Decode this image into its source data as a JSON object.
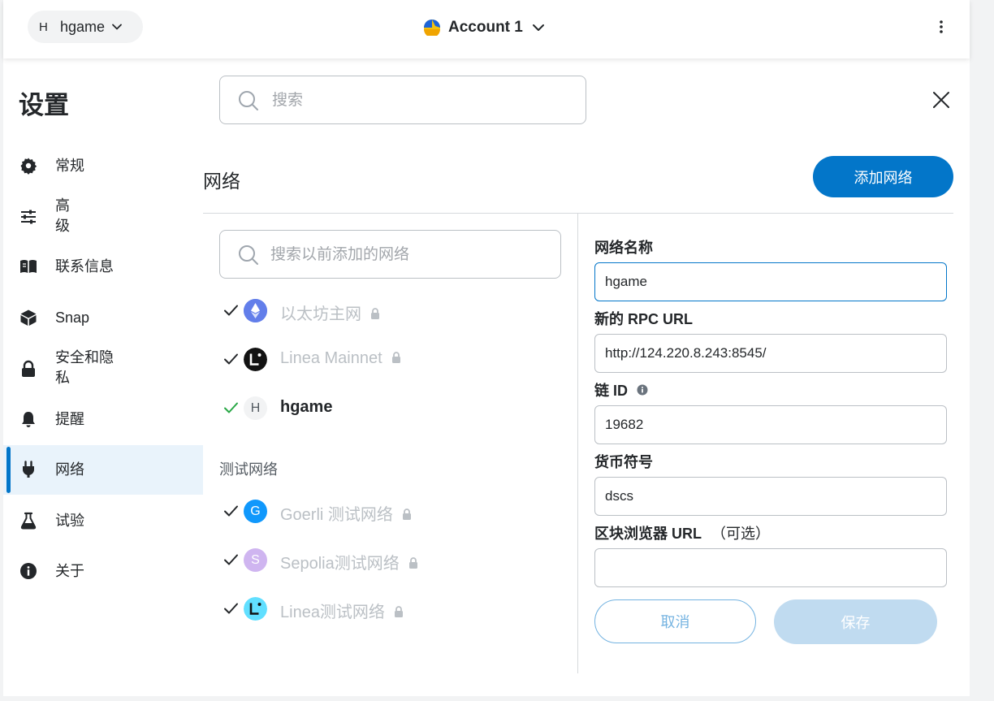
{
  "header": {
    "network_pill": {
      "letter": "H",
      "name": "hgame"
    },
    "account_name": "Account 1"
  },
  "settings": {
    "title": "设置",
    "search_placeholder": "搜索",
    "nav": [
      {
        "label": "常规",
        "icon": "gear-icon"
      },
      {
        "label": "高\n级",
        "icon": "sliders-icon"
      },
      {
        "label": "联系信息",
        "icon": "book-icon"
      },
      {
        "label": "Snap",
        "icon": "cube-icon"
      },
      {
        "label": "安全和隐\n私",
        "icon": "lock-icon"
      },
      {
        "label": "提醒",
        "icon": "bell-icon"
      },
      {
        "label": "网络",
        "icon": "plug-icon",
        "active": true
      },
      {
        "label": "试验",
        "icon": "flask-icon"
      },
      {
        "label": "关于",
        "icon": "info-icon"
      }
    ]
  },
  "networks": {
    "title": "网络",
    "add_button": "添加网络",
    "list_search_placeholder": "搜索以前添加的网络",
    "main": [
      {
        "name": "以太坊主网",
        "locked": true,
        "logo": "ethereum-logo",
        "color": "#627eea"
      },
      {
        "name": "Linea Mainnet",
        "locked": true,
        "logo": "linea-logo",
        "color": "#121212"
      },
      {
        "name": "hgame",
        "letter": "H",
        "selected": true
      }
    ],
    "test_heading": "测试网络",
    "test": [
      {
        "name": "Goerli 测试网络",
        "letter": "G",
        "locked": true,
        "color": "#1098fc"
      },
      {
        "name": "Sepolia测试网络",
        "letter": "S",
        "locked": true,
        "color": "#cfb5f0"
      },
      {
        "name": "Linea测试网络",
        "locked": true,
        "logo": "linea-test-logo",
        "color": "#61dfff"
      }
    ]
  },
  "form": {
    "name_label": "网络名称",
    "name_value": "hgame",
    "rpc_label": "新的 RPC URL",
    "rpc_value": "http://124.220.8.243:8545/",
    "chain_label": "链 ID",
    "chain_value": "19682",
    "symbol_label": "货币符号",
    "symbol_value": "dscs",
    "explorer_label": "区块浏览器 URL",
    "explorer_optional": "（可选）",
    "explorer_value": "",
    "cancel": "取消",
    "save": "保存"
  },
  "colors": {
    "primary": "#0376c9",
    "success_check": "#28a745",
    "muted_text": "#bbc0c5"
  }
}
